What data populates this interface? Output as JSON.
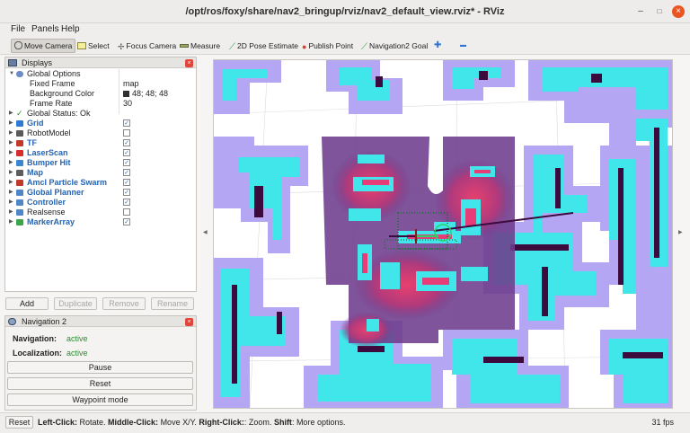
{
  "window": {
    "title": "/opt/ros/foxy/share/nav2_bringup/rviz/nav2_default_view.rviz* - RViz",
    "min_glyph": "–",
    "max_glyph": "□",
    "close_glyph": "×"
  },
  "menu": [
    "File",
    "Panels",
    "Help"
  ],
  "toolbar": {
    "tools": [
      {
        "label": "Move Camera",
        "icon": "move-camera-icon",
        "active": true
      },
      {
        "label": "Select",
        "icon": "select-icon"
      },
      {
        "label": "Focus Camera",
        "icon": "focus-camera-icon"
      },
      {
        "label": "Measure",
        "icon": "measure-icon"
      },
      {
        "label": "2D Pose Estimate",
        "icon": "pose-estimate-icon"
      },
      {
        "label": "Publish Point",
        "icon": "publish-point-icon"
      },
      {
        "label": "Navigation2 Goal",
        "icon": "nav-goal-icon"
      }
    ],
    "add_glyph": "✚",
    "remove_glyph": "▬"
  },
  "displays": {
    "title": "Displays",
    "global_options": {
      "label": "Global Options",
      "fixed_frame": {
        "label": "Fixed Frame",
        "value": "map"
      },
      "background": {
        "label": "Background Color",
        "value": "48; 48; 48"
      },
      "frame_rate": {
        "label": "Frame Rate",
        "value": "30"
      }
    },
    "global_status": "Global Status: Ok",
    "items": [
      {
        "label": "Grid",
        "icon": "grid-icon",
        "color": "#2d7ad6",
        "checked": true,
        "highlight": true
      },
      {
        "label": "RobotModel",
        "icon": "robot-model-icon",
        "color": "#5a5a5a",
        "checked": false,
        "highlight": false
      },
      {
        "label": "TF",
        "icon": "tf-icon",
        "color": "#c0392b",
        "checked": true,
        "highlight": true
      },
      {
        "label": "LaserScan",
        "icon": "laser-scan-icon",
        "color": "#d62c2c",
        "checked": true,
        "highlight": true
      },
      {
        "label": "Bumper Hit",
        "icon": "bumper-hit-icon",
        "color": "#3a86d0",
        "checked": true,
        "highlight": true
      },
      {
        "label": "Map",
        "icon": "map-icon",
        "color": "#5d5d5d",
        "checked": true,
        "highlight": true
      },
      {
        "label": "Amcl Particle Swarm",
        "icon": "particle-swarm-icon",
        "color": "#c0392b",
        "checked": true,
        "highlight": true
      },
      {
        "label": "Global Planner",
        "icon": "folder-icon",
        "color": "#4f86c6",
        "checked": true,
        "highlight": true
      },
      {
        "label": "Controller",
        "icon": "folder-icon",
        "color": "#4f86c6",
        "checked": true,
        "highlight": true
      },
      {
        "label": "Realsense",
        "icon": "folder-icon",
        "color": "#4f86c6",
        "checked": false,
        "highlight": false
      },
      {
        "label": "MarkerArray",
        "icon": "marker-array-icon",
        "color": "#3aa648",
        "checked": true,
        "highlight": true
      }
    ],
    "buttons": {
      "add": "Add",
      "duplicate": "Duplicate",
      "remove": "Remove",
      "rename": "Rename"
    }
  },
  "navigation": {
    "title": "Navigation 2",
    "navigation_label": "Navigation:",
    "navigation_value": "active",
    "localization_label": "Localization:",
    "localization_value": "active",
    "pause": "Pause",
    "reset": "Reset",
    "waypoint": "Waypoint mode"
  },
  "status": {
    "reset": "Reset",
    "hint_parts": [
      {
        "text": "Left-Click:",
        "bold": true
      },
      {
        "text": " Rotate. ",
        "bold": false
      },
      {
        "text": "Middle-Click:",
        "bold": true
      },
      {
        "text": " Move X/Y. ",
        "bold": false
      },
      {
        "text": "Right-Click:",
        "bold": true
      },
      {
        "text": ": Zoom. ",
        "bold": false
      },
      {
        "text": "Shift",
        "bold": true
      },
      {
        "text": ": More options.",
        "bold": false
      }
    ],
    "fps": "31 fps"
  },
  "colors": {
    "costmap_halo": "#b4a6f2",
    "inflation": "#41e6ea",
    "obstacle": "#3d0a3e",
    "local_costmap": "#6e3c8c",
    "high_cost": "#e63c78",
    "checkbox": "#2b70c4"
  }
}
